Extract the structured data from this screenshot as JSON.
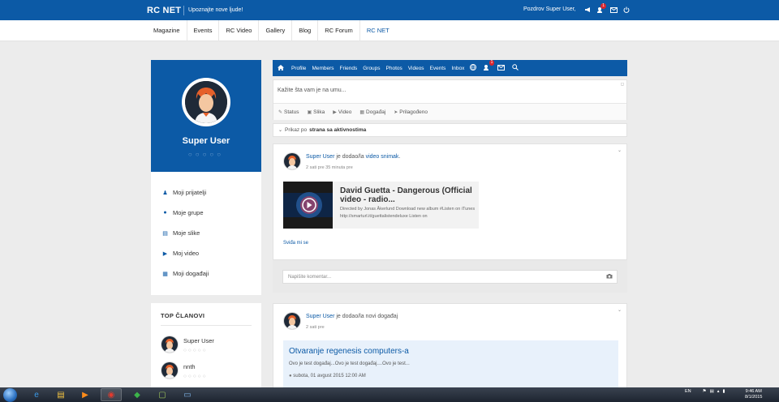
{
  "header": {
    "brand": "RC NET",
    "tagline": "Upoznajte nove ljude!",
    "greeting": "Pozdrov Super User,",
    "notification_count": "1"
  },
  "nav": {
    "items": [
      {
        "label": "Magazine"
      },
      {
        "label": "Events"
      },
      {
        "label": "RC Video"
      },
      {
        "label": "Gallery"
      },
      {
        "label": "Blog"
      },
      {
        "label": "RC Forum"
      },
      {
        "label": "RC NET"
      }
    ],
    "active": "RC NET"
  },
  "profile": {
    "name": "Super User",
    "stars": "○○○○○"
  },
  "sidebar": {
    "items": [
      {
        "label": "Moji prijatelji",
        "icon": "user-icon"
      },
      {
        "label": "Moje grupe",
        "icon": "users-icon"
      },
      {
        "label": "Moje slike",
        "icon": "image-icon"
      },
      {
        "label": "Moj video",
        "icon": "video-icon"
      },
      {
        "label": "Moji događaji",
        "icon": "calendar-icon"
      }
    ]
  },
  "top_members": {
    "title": "TOP ČLANOVI",
    "members": [
      {
        "name": "Super User",
        "stars": "○○○○○"
      },
      {
        "name": "nnth",
        "stars": "○○○○○"
      }
    ]
  },
  "toolbar": {
    "items": [
      "Profile",
      "Members",
      "Friends",
      "Groups",
      "Photos",
      "Videos",
      "Events",
      "Inbox"
    ],
    "notification_count": "1"
  },
  "status": {
    "placeholder": "Kažite šta vam je na umu...",
    "tabs": [
      "Status",
      "Slika",
      "Video",
      "Događaj",
      "Prilagođeno"
    ]
  },
  "filter": {
    "prefix": "Prikaz po",
    "value": "strana sa aktivnostima"
  },
  "posts": [
    {
      "user": "Super User",
      "action": " je dodao/la ",
      "object": "video snimak",
      "object_suffix": ".",
      "time": "2 sati pre 35 minuta pre",
      "video": {
        "title": "David Guetta - Dangerous (Official video - radio...",
        "description": "Directed by Jonas Åkerlund Download new album #Listen on iTunes http://smarturl.it/guettalistendeluxe Listen on"
      },
      "like_label": "Sviđa mi se",
      "comment_placeholder": "Napišite komentar..."
    },
    {
      "user": "Super User",
      "action": " je dodao/la novi događaj",
      "time": "2 sati pre",
      "event": {
        "title": "Otvaranje regenesis computers-a",
        "description": "Ovo je test događaj...Ovo je test događaj....Ovo je test...",
        "date": "subota, 01 avgust 2015 12:00 AM"
      }
    }
  ],
  "taskbar": {
    "language": "EN",
    "time": "9:46 AM",
    "date": "8/1/2015"
  },
  "colors": {
    "brand_blue": "#0c5aa6",
    "badge_red": "#d9262f"
  }
}
